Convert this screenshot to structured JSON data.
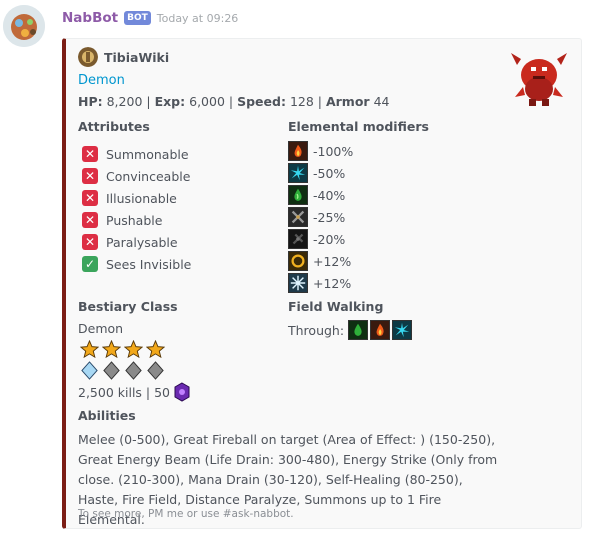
{
  "message": {
    "username": "NabBot",
    "bot_tag": "BOT",
    "timestamp": "Today at 09:26"
  },
  "embed": {
    "accent_color": "#7c1e15",
    "author": "TibiaWiki",
    "title": "Demon",
    "stats": {
      "hp_label": "HP:",
      "hp": "8,200",
      "exp_label": "Exp:",
      "exp": "6,000",
      "speed_label": "Speed:",
      "speed": "128",
      "armor_label": "Armor",
      "armor": "44"
    },
    "attributes": {
      "heading": "Attributes",
      "items": [
        {
          "label": "Summonable",
          "state": "no"
        },
        {
          "label": "Convinceable",
          "state": "no"
        },
        {
          "label": "Illusionable",
          "state": "no"
        },
        {
          "label": "Pushable",
          "state": "no"
        },
        {
          "label": "Paralysable",
          "state": "no"
        },
        {
          "label": "Sees Invisible",
          "state": "yes"
        }
      ]
    },
    "elemental_modifiers": {
      "heading": "Elemental modifiers",
      "items": [
        {
          "element": "fire-icon",
          "value": "-100%"
        },
        {
          "element": "energy-icon",
          "value": "-50%"
        },
        {
          "element": "earth-icon",
          "value": "-40%"
        },
        {
          "element": "physical-icon",
          "value": "-25%"
        },
        {
          "element": "death-icon",
          "value": "-20%"
        },
        {
          "element": "holy-icon",
          "value": "+12%"
        },
        {
          "element": "ice-icon",
          "value": "+12%"
        }
      ]
    },
    "bestiary": {
      "heading": "Bestiary Class",
      "class": "Demon",
      "difficulty_stars": 4,
      "occurrence_gems": 4,
      "kills": "2,500 kills | 50"
    },
    "field_walking": {
      "heading": "Field Walking",
      "through_label": "Through:",
      "fields": [
        "earth-field-icon",
        "fire-field-icon",
        "energy-field-icon"
      ]
    },
    "abilities": {
      "heading": "Abilities",
      "text": "Melee (0-500), Great Fireball on target (Area of Effect: ) (150-250), Great Energy Beam (Life Drain: 300-480), Energy Strike (Only from close. (210-300), Mana Drain (30-120), Self-Healing (80-250), Haste, Fire Field, Distance Paralyze, Summons up to 1 Fire Elemental."
    },
    "footer": "To see more, PM me or use #ask-nabbot."
  }
}
